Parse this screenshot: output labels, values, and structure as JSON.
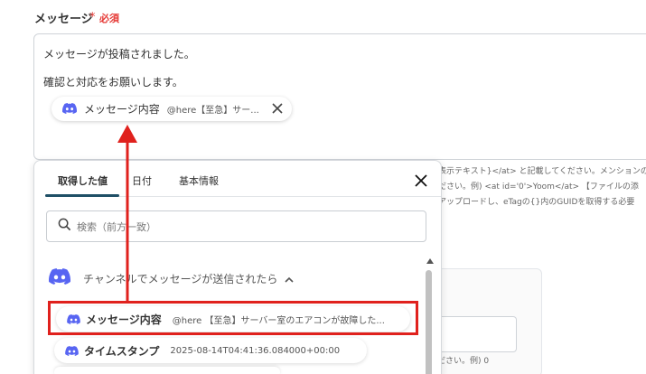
{
  "field": {
    "label": "メッセージ",
    "required_star": "*",
    "required_text": "必須"
  },
  "message": {
    "line1": "メッセージが投稿されました。",
    "line2": "確認と対応をお願いします。"
  },
  "chip": {
    "name": "メッセージ内容",
    "value": "@here【至急】サー..."
  },
  "background_text": {
    "line1": "表示テキスト}</at> と記載してください。メンションの",
    "line2": "ださい。例) <at id='0'>Yoom</at> 【ファイルの添",
    "line3": "アップロードし、eTagの{}内のGUIDを取得する必要",
    "hint": "ださい。例) 0"
  },
  "panel": {
    "tabs": [
      {
        "label": "取得した値",
        "active": true
      },
      {
        "label": "日付",
        "active": false
      },
      {
        "label": "基本情報",
        "active": false
      }
    ],
    "search_placeholder": "検索（前方一致）",
    "group_label": "チャンネルでメッセージが送信されたら",
    "items": [
      {
        "name": "メッセージ内容",
        "value": "@here 【至急】サーバー室のエアコンが故障した..."
      },
      {
        "name": "タイムスタンプ",
        "value": "2025-08-14T04:41:36.084000+00:00"
      }
    ]
  },
  "colors": {
    "accent": "#1f4f66",
    "discord": "#5865F2",
    "highlight": "#e0211d",
    "required": "#e53935"
  }
}
